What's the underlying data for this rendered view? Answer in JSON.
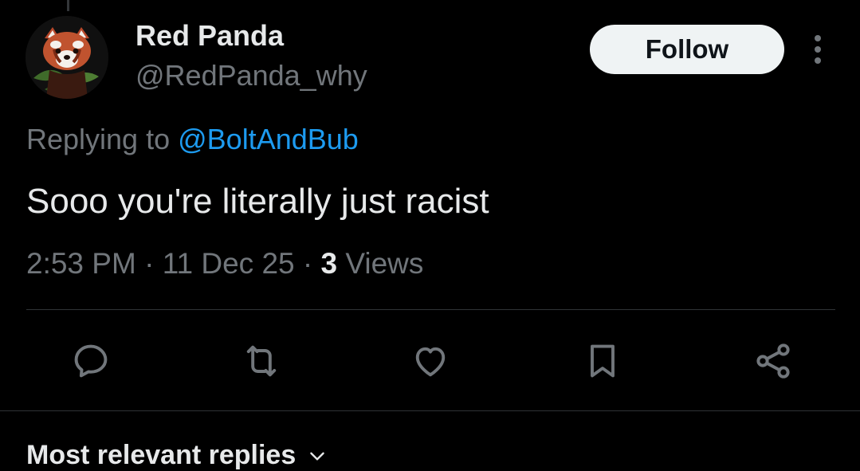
{
  "tweet": {
    "author": {
      "display_name": "Red Panda",
      "handle": "@RedPanda_why",
      "avatar_icon": "red-panda-avatar"
    },
    "follow_label": "Follow",
    "more_icon": "more-vertical-icon",
    "replying_prefix": "Replying to ",
    "replying_to": "@BoltAndBub",
    "text": "Sooo you're literally just racist",
    "meta": {
      "time": "2:53 PM",
      "separator": " · ",
      "date": "11 Dec 25",
      "views_count": "3",
      "views_label": " Views"
    },
    "actions": [
      {
        "name": "reply",
        "icon": "reply-icon"
      },
      {
        "name": "retweet",
        "icon": "retweet-icon"
      },
      {
        "name": "like",
        "icon": "heart-icon"
      },
      {
        "name": "bookmark",
        "icon": "bookmark-icon"
      },
      {
        "name": "share",
        "icon": "share-icon"
      }
    ]
  },
  "replies": {
    "sort_label": "Most relevant replies"
  },
  "colors": {
    "background": "#000000",
    "text_primary": "#e7e9ea",
    "text_secondary": "#71767b",
    "link": "#1d9bf0",
    "icon": "#71767b",
    "divider": "#2f3336",
    "follow_bg": "#eff3f4"
  }
}
